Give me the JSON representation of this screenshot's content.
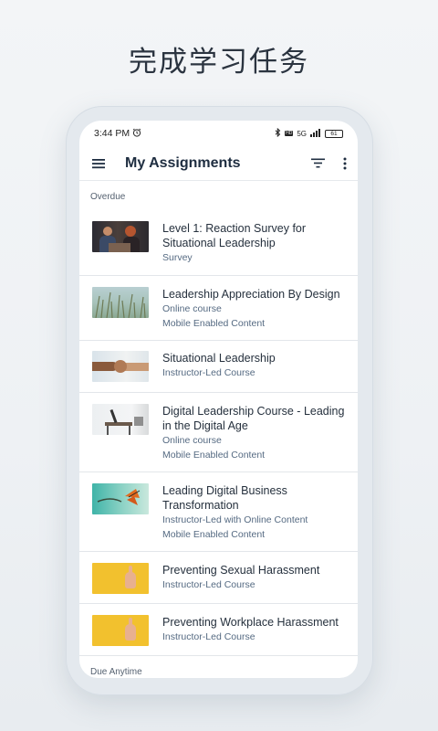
{
  "promo": {
    "title": "完成学习任务"
  },
  "statusbar": {
    "time": "3:44 PM",
    "network": "5G",
    "battery": "61"
  },
  "appbar": {
    "title": "My Assignments"
  },
  "sections": {
    "overdue": "Overdue",
    "due_anytime": "Due Anytime"
  },
  "assignments": [
    {
      "title": "Level 1: Reaction Survey for Situational Leadership",
      "subs": [
        "Survey"
      ],
      "thumb": "people-photo"
    },
    {
      "title": "Leadership Appreciation By Design",
      "subs": [
        "Online course",
        "Mobile Enabled Content"
      ],
      "thumb": "grass-photo"
    },
    {
      "title": "Situational Leadership",
      "subs": [
        "Instructor-Led Course"
      ],
      "thumb": "handshake-photo"
    },
    {
      "title": "Digital Leadership Course - Leading in the Digital Age",
      "subs": [
        "Online course",
        "Mobile Enabled Content"
      ],
      "thumb": "desk-photo"
    },
    {
      "title": "Leading Digital Business Transformation",
      "subs": [
        "Instructor-Led with Online Content",
        "Mobile Enabled Content"
      ],
      "thumb": "butterfly-photo"
    },
    {
      "title": "Preventing Sexual Harassment",
      "subs": [
        "Instructor-Led Course"
      ],
      "thumb": "hand-yellow-photo"
    },
    {
      "title": "Preventing Workplace Harassment",
      "subs": [
        "Instructor-Led Course"
      ],
      "thumb": "hand-yellow-photo"
    }
  ],
  "colors": {
    "title": "#1e2d40",
    "subtitle": "#556a82",
    "accent_yellow": "#f2c12e"
  }
}
